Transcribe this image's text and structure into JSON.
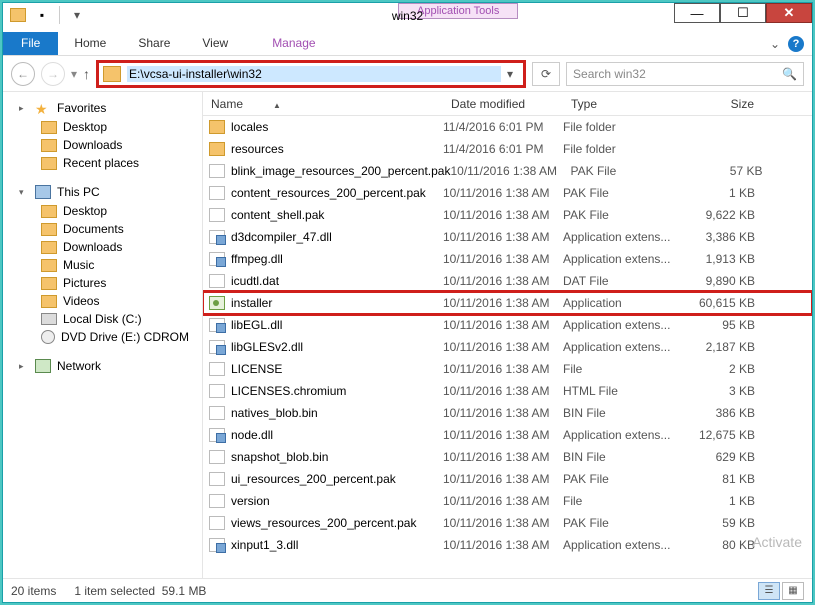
{
  "window": {
    "title": "win32",
    "context_tab_label": "Application Tools"
  },
  "ribbon": {
    "file": "File",
    "tabs": [
      "Home",
      "Share",
      "View"
    ],
    "context_tab": "Manage"
  },
  "address": {
    "path": "E:\\vcsa-ui-installer\\win32",
    "search_placeholder": "Search win32"
  },
  "nav": {
    "favorites": "Favorites",
    "fav_items": [
      "Desktop",
      "Downloads",
      "Recent places"
    ],
    "this_pc": "This PC",
    "pc_items": [
      "Desktop",
      "Documents",
      "Downloads",
      "Music",
      "Pictures",
      "Videos",
      "Local Disk (C:)",
      "DVD Drive (E:) CDROM"
    ],
    "network": "Network"
  },
  "columns": {
    "name": "Name",
    "date": "Date modified",
    "type": "Type",
    "size": "Size"
  },
  "files": [
    {
      "icon": "folder",
      "name": "locales",
      "date": "11/4/2016 6:01 PM",
      "type": "File folder",
      "size": ""
    },
    {
      "icon": "folder",
      "name": "resources",
      "date": "11/4/2016 6:01 PM",
      "type": "File folder",
      "size": ""
    },
    {
      "icon": "pak",
      "name": "blink_image_resources_200_percent.pak",
      "date": "10/11/2016 1:38 AM",
      "type": "PAK File",
      "size": "57 KB"
    },
    {
      "icon": "pak",
      "name": "content_resources_200_percent.pak",
      "date": "10/11/2016 1:38 AM",
      "type": "PAK File",
      "size": "1 KB"
    },
    {
      "icon": "pak",
      "name": "content_shell.pak",
      "date": "10/11/2016 1:38 AM",
      "type": "PAK File",
      "size": "9,622 KB"
    },
    {
      "icon": "dll",
      "name": "d3dcompiler_47.dll",
      "date": "10/11/2016 1:38 AM",
      "type": "Application extens...",
      "size": "3,386 KB"
    },
    {
      "icon": "dll",
      "name": "ffmpeg.dll",
      "date": "10/11/2016 1:38 AM",
      "type": "Application extens...",
      "size": "1,913 KB"
    },
    {
      "icon": "dat",
      "name": "icudtl.dat",
      "date": "10/11/2016 1:38 AM",
      "type": "DAT File",
      "size": "9,890 KB"
    },
    {
      "icon": "app",
      "name": "installer",
      "date": "10/11/2016 1:38 AM",
      "type": "Application",
      "size": "60,615 KB",
      "highlight": true
    },
    {
      "icon": "dll",
      "name": "libEGL.dll",
      "date": "10/11/2016 1:38 AM",
      "type": "Application extens...",
      "size": "95 KB"
    },
    {
      "icon": "dll",
      "name": "libGLESv2.dll",
      "date": "10/11/2016 1:38 AM",
      "type": "Application extens...",
      "size": "2,187 KB"
    },
    {
      "icon": "file",
      "name": "LICENSE",
      "date": "10/11/2016 1:38 AM",
      "type": "File",
      "size": "2 KB"
    },
    {
      "icon": "html",
      "name": "LICENSES.chromium",
      "date": "10/11/2016 1:38 AM",
      "type": "HTML File",
      "size": "3 KB"
    },
    {
      "icon": "bin",
      "name": "natives_blob.bin",
      "date": "10/11/2016 1:38 AM",
      "type": "BIN File",
      "size": "386 KB"
    },
    {
      "icon": "dll",
      "name": "node.dll",
      "date": "10/11/2016 1:38 AM",
      "type": "Application extens...",
      "size": "12,675 KB"
    },
    {
      "icon": "bin",
      "name": "snapshot_blob.bin",
      "date": "10/11/2016 1:38 AM",
      "type": "BIN File",
      "size": "629 KB"
    },
    {
      "icon": "pak",
      "name": "ui_resources_200_percent.pak",
      "date": "10/11/2016 1:38 AM",
      "type": "PAK File",
      "size": "81 KB"
    },
    {
      "icon": "file",
      "name": "version",
      "date": "10/11/2016 1:38 AM",
      "type": "File",
      "size": "1 KB"
    },
    {
      "icon": "pak",
      "name": "views_resources_200_percent.pak",
      "date": "10/11/2016 1:38 AM",
      "type": "PAK File",
      "size": "59 KB"
    },
    {
      "icon": "dll",
      "name": "xinput1_3.dll",
      "date": "10/11/2016 1:38 AM",
      "type": "Application extens...",
      "size": "80 KB"
    }
  ],
  "status": {
    "items": "20 items",
    "selected": "1 item selected",
    "sel_size": "59.1 MB"
  },
  "watermark": "Activate"
}
